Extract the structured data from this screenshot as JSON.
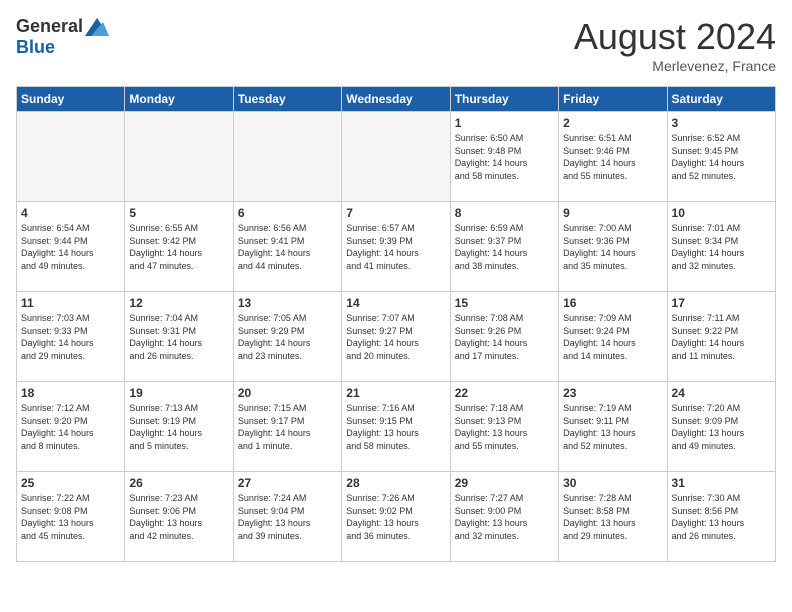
{
  "header": {
    "logo_general": "General",
    "logo_blue": "Blue",
    "month_year": "August 2024",
    "location": "Merlevenez, France"
  },
  "days_of_week": [
    "Sunday",
    "Monday",
    "Tuesday",
    "Wednesday",
    "Thursday",
    "Friday",
    "Saturday"
  ],
  "weeks": [
    [
      {
        "day": "",
        "info": ""
      },
      {
        "day": "",
        "info": ""
      },
      {
        "day": "",
        "info": ""
      },
      {
        "day": "",
        "info": ""
      },
      {
        "day": "1",
        "info": "Sunrise: 6:50 AM\nSunset: 9:48 PM\nDaylight: 14 hours\nand 58 minutes."
      },
      {
        "day": "2",
        "info": "Sunrise: 6:51 AM\nSunset: 9:46 PM\nDaylight: 14 hours\nand 55 minutes."
      },
      {
        "day": "3",
        "info": "Sunrise: 6:52 AM\nSunset: 9:45 PM\nDaylight: 14 hours\nand 52 minutes."
      }
    ],
    [
      {
        "day": "4",
        "info": "Sunrise: 6:54 AM\nSunset: 9:44 PM\nDaylight: 14 hours\nand 49 minutes."
      },
      {
        "day": "5",
        "info": "Sunrise: 6:55 AM\nSunset: 9:42 PM\nDaylight: 14 hours\nand 47 minutes."
      },
      {
        "day": "6",
        "info": "Sunrise: 6:56 AM\nSunset: 9:41 PM\nDaylight: 14 hours\nand 44 minutes."
      },
      {
        "day": "7",
        "info": "Sunrise: 6:57 AM\nSunset: 9:39 PM\nDaylight: 14 hours\nand 41 minutes."
      },
      {
        "day": "8",
        "info": "Sunrise: 6:59 AM\nSunset: 9:37 PM\nDaylight: 14 hours\nand 38 minutes."
      },
      {
        "day": "9",
        "info": "Sunrise: 7:00 AM\nSunset: 9:36 PM\nDaylight: 14 hours\nand 35 minutes."
      },
      {
        "day": "10",
        "info": "Sunrise: 7:01 AM\nSunset: 9:34 PM\nDaylight: 14 hours\nand 32 minutes."
      }
    ],
    [
      {
        "day": "11",
        "info": "Sunrise: 7:03 AM\nSunset: 9:33 PM\nDaylight: 14 hours\nand 29 minutes."
      },
      {
        "day": "12",
        "info": "Sunrise: 7:04 AM\nSunset: 9:31 PM\nDaylight: 14 hours\nand 26 minutes."
      },
      {
        "day": "13",
        "info": "Sunrise: 7:05 AM\nSunset: 9:29 PM\nDaylight: 14 hours\nand 23 minutes."
      },
      {
        "day": "14",
        "info": "Sunrise: 7:07 AM\nSunset: 9:27 PM\nDaylight: 14 hours\nand 20 minutes."
      },
      {
        "day": "15",
        "info": "Sunrise: 7:08 AM\nSunset: 9:26 PM\nDaylight: 14 hours\nand 17 minutes."
      },
      {
        "day": "16",
        "info": "Sunrise: 7:09 AM\nSunset: 9:24 PM\nDaylight: 14 hours\nand 14 minutes."
      },
      {
        "day": "17",
        "info": "Sunrise: 7:11 AM\nSunset: 9:22 PM\nDaylight: 14 hours\nand 11 minutes."
      }
    ],
    [
      {
        "day": "18",
        "info": "Sunrise: 7:12 AM\nSunset: 9:20 PM\nDaylight: 14 hours\nand 8 minutes."
      },
      {
        "day": "19",
        "info": "Sunrise: 7:13 AM\nSunset: 9:19 PM\nDaylight: 14 hours\nand 5 minutes."
      },
      {
        "day": "20",
        "info": "Sunrise: 7:15 AM\nSunset: 9:17 PM\nDaylight: 14 hours\nand 1 minute."
      },
      {
        "day": "21",
        "info": "Sunrise: 7:16 AM\nSunset: 9:15 PM\nDaylight: 13 hours\nand 58 minutes."
      },
      {
        "day": "22",
        "info": "Sunrise: 7:18 AM\nSunset: 9:13 PM\nDaylight: 13 hours\nand 55 minutes."
      },
      {
        "day": "23",
        "info": "Sunrise: 7:19 AM\nSunset: 9:11 PM\nDaylight: 13 hours\nand 52 minutes."
      },
      {
        "day": "24",
        "info": "Sunrise: 7:20 AM\nSunset: 9:09 PM\nDaylight: 13 hours\nand 49 minutes."
      }
    ],
    [
      {
        "day": "25",
        "info": "Sunrise: 7:22 AM\nSunset: 9:08 PM\nDaylight: 13 hours\nand 45 minutes."
      },
      {
        "day": "26",
        "info": "Sunrise: 7:23 AM\nSunset: 9:06 PM\nDaylight: 13 hours\nand 42 minutes."
      },
      {
        "day": "27",
        "info": "Sunrise: 7:24 AM\nSunset: 9:04 PM\nDaylight: 13 hours\nand 39 minutes."
      },
      {
        "day": "28",
        "info": "Sunrise: 7:26 AM\nSunset: 9:02 PM\nDaylight: 13 hours\nand 36 minutes."
      },
      {
        "day": "29",
        "info": "Sunrise: 7:27 AM\nSunset: 9:00 PM\nDaylight: 13 hours\nand 32 minutes."
      },
      {
        "day": "30",
        "info": "Sunrise: 7:28 AM\nSunset: 8:58 PM\nDaylight: 13 hours\nand 29 minutes."
      },
      {
        "day": "31",
        "info": "Sunrise: 7:30 AM\nSunset: 8:56 PM\nDaylight: 13 hours\nand 26 minutes."
      }
    ]
  ]
}
